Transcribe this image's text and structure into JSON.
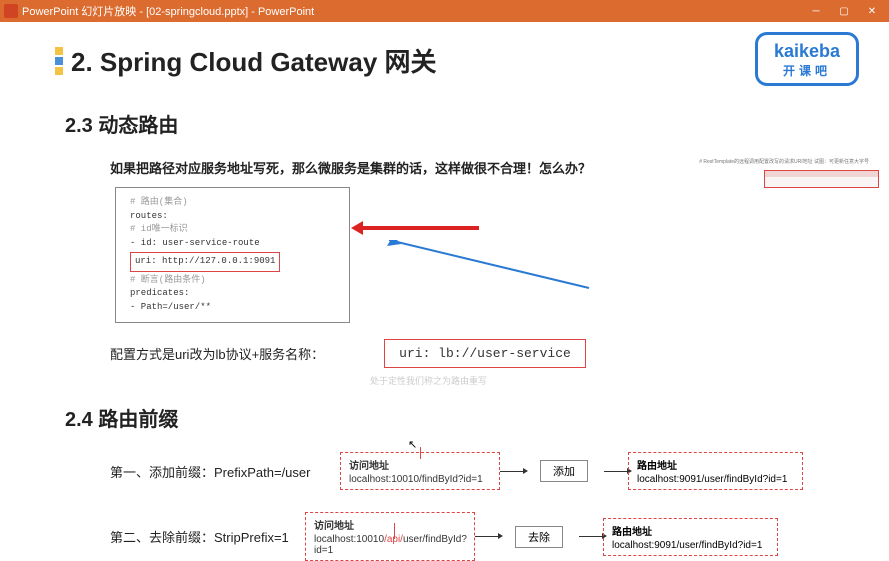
{
  "titlebar": {
    "label": "PowerPoint 幻灯片放映 - [02-springcloud.pptx] - PowerPoint"
  },
  "logo": {
    "main": "kaikeba",
    "sub": "开课吧"
  },
  "heading": "2. Spring Cloud Gateway 网关",
  "sections": {
    "s23": {
      "title": "2.3 动态路由",
      "para": "如果把路径对应服务地址写死，那么微服务是集群的话，这样做很不合理！怎么办？",
      "code": {
        "c1": "# 路由(集合)",
        "c2": "routes:",
        "c3": "  # id唯一标识",
        "c4": "  - id: user-service-route",
        "uri": "uri: http://127.0.0.1:9091",
        "c5": "  # 断言(路由条件)",
        "c6": "  predicates:",
        "c7": "    - Path=/user/**"
      },
      "config_label": "配置方式是uri改为lb协议+服务名称：",
      "config_value": "uri: lb://user-service",
      "faded": "处于定性我们称之为路由重写"
    },
    "s24": {
      "title": "2.4 路由前缀",
      "row1": {
        "label": "第一、添加前缀：PrefixPath=/user",
        "src_title": "访问地址",
        "src_url": "localhost:10010/findById?id=1",
        "btn": "添加",
        "dst_title": "路由地址",
        "dst_url_a": "localhost:9091",
        "dst_url_b": "/user/",
        "dst_url_c": "findById?id=1"
      },
      "row2": {
        "label": "第二、去除前缀：StripPrefix=1",
        "src_title": "访问地址",
        "src_url_a": "localhost:10010",
        "src_url_b": "/api/",
        "src_url_c": "user/findById?id=1",
        "btn": "去除",
        "dst_title": "路由地址",
        "dst_url": "localhost:9091/user/findById?id=1"
      }
    }
  },
  "mini_caption": "# RestTemplate的远程调用配置改写的请求URI地址 试图：可更新任意大字号"
}
